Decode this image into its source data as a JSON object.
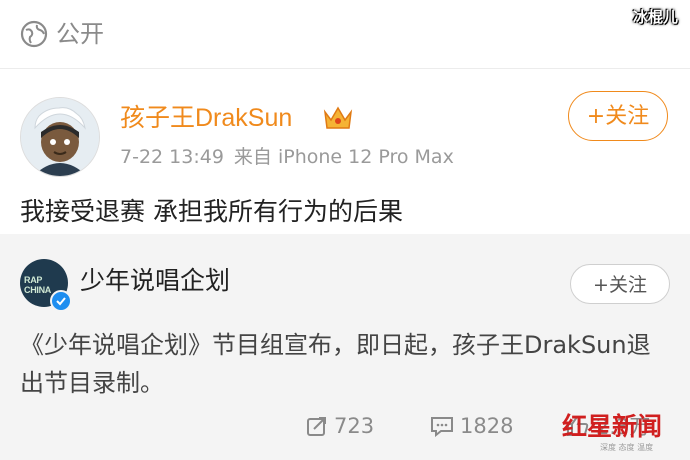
{
  "header": {
    "visibility_icon": "globe-icon",
    "visibility_label": "公开",
    "watermark": "冰棍儿"
  },
  "post": {
    "author": "孩子王DrakSun",
    "badge_icon": "crown-icon",
    "date": "7-22 13:49",
    "source": "来自 iPhone 12 Pro Max",
    "follow_label": "+关注",
    "text": "我接受退赛 承担我所有行为的后果"
  },
  "repost": {
    "avatar_text": "RAP CHINA",
    "name": "少年说唱企划",
    "follow_label": "+关注",
    "text": "《少年说唱企划》节目组宣布，即日起，孩子王DrakSun退出节目录制。"
  },
  "actions": {
    "share_count": "723",
    "comment_count": "1828",
    "like_count": "2.3万"
  },
  "logo": {
    "name": "红星新闻",
    "tagline": "深度 态度 温度"
  },
  "colors": {
    "accent": "#f08a1c",
    "logo_red": "#d01f1f",
    "verified_blue": "#1e8ef0"
  }
}
